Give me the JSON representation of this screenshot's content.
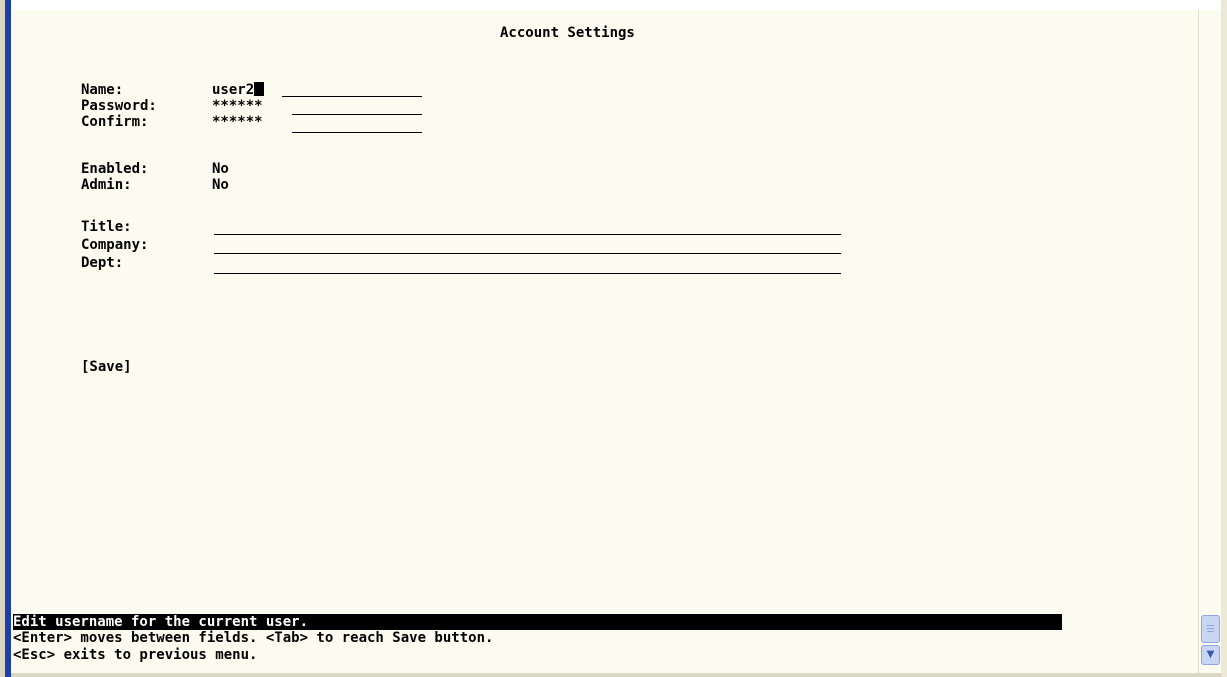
{
  "screen": {
    "title": "Account Settings"
  },
  "form": {
    "name": {
      "label": "Name:",
      "value": "user2"
    },
    "password": {
      "label": "Password:",
      "value": "******"
    },
    "confirm": {
      "label": "Confirm:",
      "value": "******"
    },
    "enabled": {
      "label": "Enabled:",
      "value": "No"
    },
    "admin": {
      "label": "Admin:",
      "value": "No"
    },
    "title": {
      "label": "Title:",
      "value": ""
    },
    "company": {
      "label": "Company:",
      "value": ""
    },
    "dept": {
      "label": "Dept:",
      "value": ""
    }
  },
  "save_button": {
    "label": "[Save]"
  },
  "status_bar": {
    "message": "Edit username for the current user.",
    "help_lines": [
      "<Enter> moves between fields. <Tab> to reach Save button.",
      "<Esc> exits to previous menu."
    ]
  },
  "scrollbar": {
    "grip_icon": "scroll-grip-icon",
    "down_icon": "chevron-down-icon"
  },
  "colors": {
    "console_background": "#fbfbef",
    "window_edge": "#1f3fa8",
    "highlight": "#000000"
  }
}
